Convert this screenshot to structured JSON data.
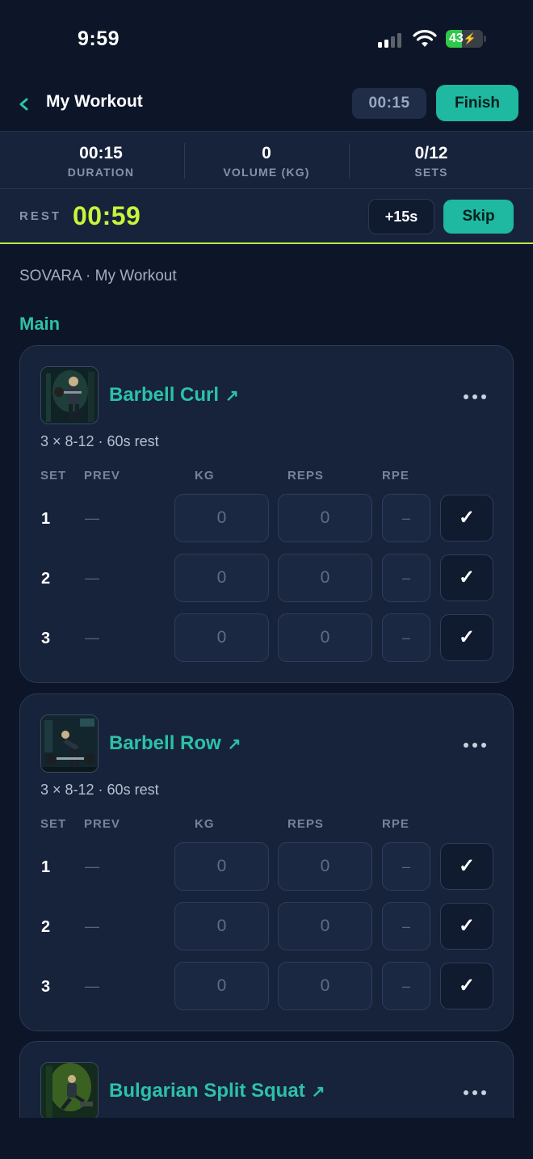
{
  "status_bar": {
    "time": "9:59",
    "battery": "43"
  },
  "header": {
    "back_icon": "chevron-left-icon",
    "title": "My Workout",
    "timer": "00:15",
    "finish_label": "Finish"
  },
  "stats": [
    {
      "value": "00:15",
      "label": "DURATION"
    },
    {
      "value": "0",
      "label": "VOLUME (KG)"
    },
    {
      "value": "0/12",
      "label": "SETS"
    }
  ],
  "rest": {
    "label": "REST",
    "time": "00:59",
    "add_label": "+15s",
    "skip_label": "Skip"
  },
  "breadcrumb": "SOVARA · My Workout",
  "section_title": "Main",
  "table_headers": {
    "set": "SET",
    "prev": "PREV",
    "kg": "KG",
    "reps": "REPS",
    "rpe": "RPE"
  },
  "exercises": [
    {
      "name": "Barbell Curl",
      "scheme": "3 × 8-12 · 60s rest",
      "sets": [
        {
          "num": "1",
          "prev": "—",
          "kg": "0",
          "reps": "0",
          "rpe": "–"
        },
        {
          "num": "2",
          "prev": "—",
          "kg": "0",
          "reps": "0",
          "rpe": "–"
        },
        {
          "num": "3",
          "prev": "—",
          "kg": "0",
          "reps": "0",
          "rpe": "–"
        }
      ]
    },
    {
      "name": "Barbell Row",
      "scheme": "3 × 8-12 · 60s rest",
      "sets": [
        {
          "num": "1",
          "prev": "—",
          "kg": "0",
          "reps": "0",
          "rpe": "–"
        },
        {
          "num": "2",
          "prev": "—",
          "kg": "0",
          "reps": "0",
          "rpe": "–"
        },
        {
          "num": "3",
          "prev": "—",
          "kg": "0",
          "reps": "0",
          "rpe": "–"
        }
      ]
    },
    {
      "name": "Bulgarian Split Squat"
    }
  ],
  "icons": {
    "link": "arrow-up-right-icon",
    "more": "more-horizontal-icon",
    "check": "checkmark-icon"
  },
  "colors": {
    "accent": "#1fb8a1",
    "rest_timer": "#c8f43c",
    "background": "#0d1628",
    "card": "#17233b"
  }
}
